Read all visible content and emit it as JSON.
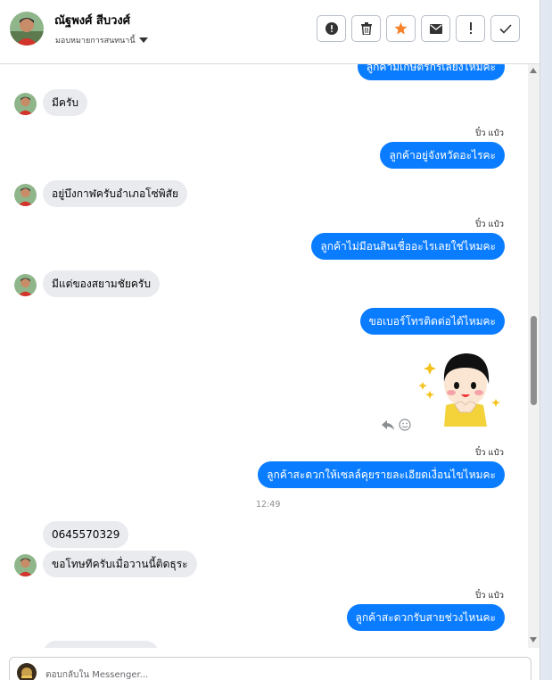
{
  "header": {
    "contact_name": "ณัฐพงศ์ สีบวงศ์",
    "assign_label": "มอบหมายการสนทนานี้",
    "actions": [
      {
        "icon": "alert-circle-icon"
      },
      {
        "icon": "trash-icon"
      },
      {
        "icon": "star-icon",
        "color": "#f5822a"
      },
      {
        "icon": "mail-icon"
      },
      {
        "icon": "exclamation-icon"
      },
      {
        "icon": "check-icon"
      }
    ]
  },
  "colors": {
    "outgoing_bubble": "#0a7cff",
    "incoming_bubble": "#e9ebef",
    "star": "#f5822a"
  },
  "messages": [
    {
      "dir": "out",
      "text": "ลูกค้ามีเกษตรกรเลี้ยงไหมคะ"
    },
    {
      "dir": "in",
      "text": "มีครับ"
    },
    {
      "dir": "out",
      "sender": "ปิ๋ว แป๋ว",
      "text": "ลูกค้าอยู่จังหวัดอะไรคะ"
    },
    {
      "dir": "in",
      "text": "อยู่บึงกาฬครับอำเภอโซ่พิสัย"
    },
    {
      "dir": "out",
      "sender": "ปิ๋ว แป๋ว",
      "text": "ลูกค้าไม่มีอนสินเชื่ออะไรเลยใช่ไหมคะ"
    },
    {
      "dir": "in",
      "text": "มีแต่ของสยามชัยครับ"
    },
    {
      "dir": "out",
      "text": "ขอเบอร์โทรติดต่อได้ไหมคะ"
    },
    {
      "dir": "out",
      "type": "sticker",
      "icon": "girl-sticker"
    },
    {
      "dir": "out",
      "sender": "ปิ๋ว แป๋ว",
      "text": "ลูกค้าสะดวกให้เซลล์คุยรายละเอียดเงื่อนไขไหมคะ"
    },
    {
      "type": "time",
      "text": "12:49"
    },
    {
      "dir": "in",
      "text": "0645570329"
    },
    {
      "dir": "in",
      "text": "ขอโทษทีครับเมื่อวานนี้ติดธุระ"
    },
    {
      "dir": "out",
      "sender": "ปิ๋ว แป๋ว",
      "text": "ลูกค้าสะดวกรับสายช่วงไหนคะ"
    }
  ],
  "reply": {
    "placeholder": "ตอบกลับใน Messenger..."
  }
}
